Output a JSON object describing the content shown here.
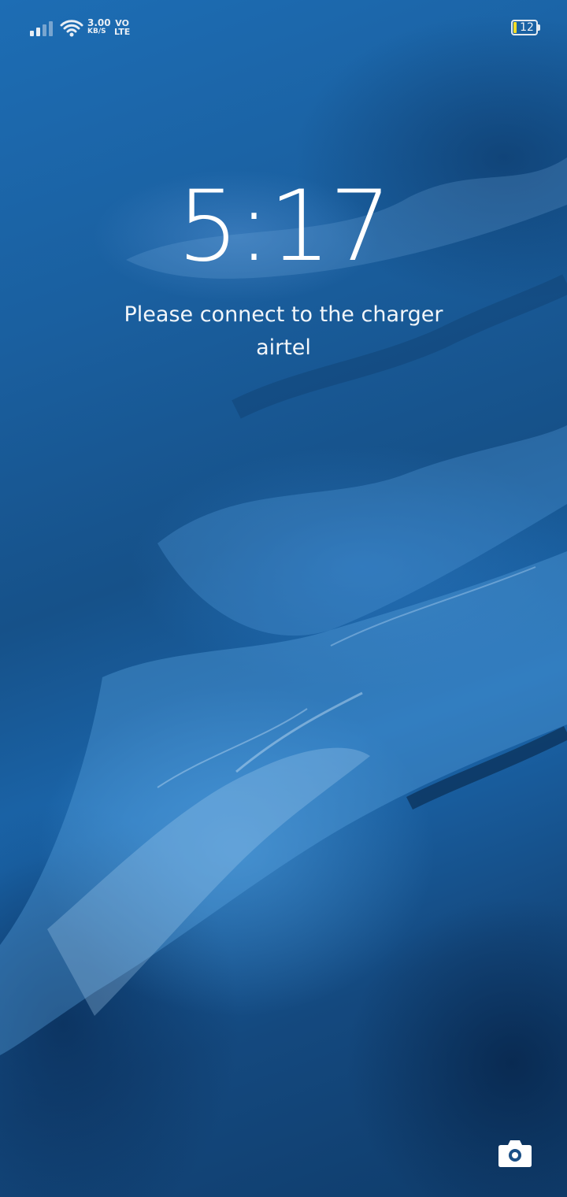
{
  "status_bar": {
    "network_speed": "3.00",
    "network_speed_unit": "KB/S",
    "volte_top": "VO",
    "volte_bottom": "LTE",
    "battery_level": "12",
    "signal_icon": "signal-bars-icon",
    "wifi_icon": "wifi-icon",
    "battery_icon": "battery-icon",
    "battery_fill_color": "#f3dd26"
  },
  "lockscreen": {
    "time": "5:17",
    "charge_message": "Please connect to the charger",
    "carrier": "airtel"
  },
  "shortcuts": {
    "camera_icon": "camera-icon"
  },
  "colors": {
    "wallpaper_primary": "#1b67ad",
    "wallpaper_dark": "#0f3c6b",
    "text": "#ffffff"
  }
}
